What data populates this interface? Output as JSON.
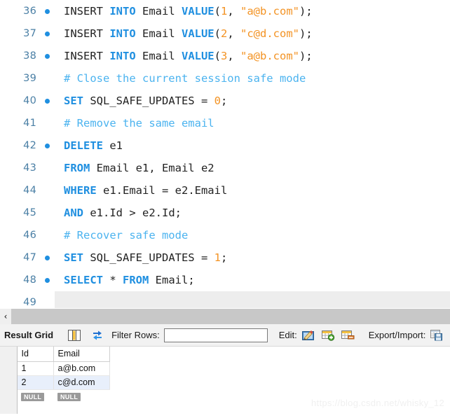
{
  "editor": {
    "lines": [
      {
        "num": "36",
        "bullet": true,
        "current": false,
        "tokens": [
          {
            "t": "INSERT ",
            "c": "plain"
          },
          {
            "t": "INTO",
            "c": "kw"
          },
          {
            "t": " Email ",
            "c": "plain"
          },
          {
            "t": "VALUE",
            "c": "kw"
          },
          {
            "t": "(",
            "c": "plain"
          },
          {
            "t": "1",
            "c": "lit"
          },
          {
            "t": ", ",
            "c": "plain"
          },
          {
            "t": "\"a@b.com\"",
            "c": "lit"
          },
          {
            "t": ");",
            "c": "plain"
          }
        ]
      },
      {
        "num": "37",
        "bullet": true,
        "current": false,
        "tokens": [
          {
            "t": "INSERT ",
            "c": "plain"
          },
          {
            "t": "INTO",
            "c": "kw"
          },
          {
            "t": " Email ",
            "c": "plain"
          },
          {
            "t": "VALUE",
            "c": "kw"
          },
          {
            "t": "(",
            "c": "plain"
          },
          {
            "t": "2",
            "c": "lit"
          },
          {
            "t": ", ",
            "c": "plain"
          },
          {
            "t": "\"c@d.com\"",
            "c": "lit"
          },
          {
            "t": ");",
            "c": "plain"
          }
        ]
      },
      {
        "num": "38",
        "bullet": true,
        "current": false,
        "tokens": [
          {
            "t": "INSERT ",
            "c": "plain"
          },
          {
            "t": "INTO",
            "c": "kw"
          },
          {
            "t": " Email ",
            "c": "plain"
          },
          {
            "t": "VALUE",
            "c": "kw"
          },
          {
            "t": "(",
            "c": "plain"
          },
          {
            "t": "3",
            "c": "lit"
          },
          {
            "t": ", ",
            "c": "plain"
          },
          {
            "t": "\"a@b.com\"",
            "c": "lit"
          },
          {
            "t": ");",
            "c": "plain"
          }
        ]
      },
      {
        "num": "39",
        "bullet": false,
        "current": false,
        "tokens": [
          {
            "t": "# Close the current session safe mode",
            "c": "comment"
          }
        ]
      },
      {
        "num": "40",
        "bullet": true,
        "current": false,
        "tokens": [
          {
            "t": "SET",
            "c": "kw"
          },
          {
            "t": " SQL_SAFE_UPDATES = ",
            "c": "plain"
          },
          {
            "t": "0",
            "c": "lit"
          },
          {
            "t": ";",
            "c": "plain"
          }
        ]
      },
      {
        "num": "41",
        "bullet": false,
        "current": false,
        "tokens": [
          {
            "t": "# Remove the same email",
            "c": "comment"
          }
        ]
      },
      {
        "num": "42",
        "bullet": true,
        "current": false,
        "tokens": [
          {
            "t": "DELETE",
            "c": "kw"
          },
          {
            "t": " e1",
            "c": "plain"
          }
        ]
      },
      {
        "num": "43",
        "bullet": false,
        "current": false,
        "tokens": [
          {
            "t": "FROM",
            "c": "kw"
          },
          {
            "t": " Email e1, Email e2",
            "c": "plain"
          }
        ]
      },
      {
        "num": "44",
        "bullet": false,
        "current": false,
        "tokens": [
          {
            "t": "WHERE",
            "c": "kw"
          },
          {
            "t": " e1.Email = e2.Email",
            "c": "plain"
          }
        ]
      },
      {
        "num": "45",
        "bullet": false,
        "current": false,
        "tokens": [
          {
            "t": "AND",
            "c": "kw"
          },
          {
            "t": " e1.Id > e2.Id;",
            "c": "plain"
          }
        ]
      },
      {
        "num": "46",
        "bullet": false,
        "current": false,
        "tokens": [
          {
            "t": "# Recover safe mode",
            "c": "comment"
          }
        ]
      },
      {
        "num": "47",
        "bullet": true,
        "current": false,
        "tokens": [
          {
            "t": "SET",
            "c": "kw"
          },
          {
            "t": " SQL_SAFE_UPDATES = ",
            "c": "plain"
          },
          {
            "t": "1",
            "c": "lit"
          },
          {
            "t": ";",
            "c": "plain"
          }
        ]
      },
      {
        "num": "48",
        "bullet": true,
        "current": false,
        "tokens": [
          {
            "t": "SELECT",
            "c": "kw"
          },
          {
            "t": " * ",
            "c": "plain"
          },
          {
            "t": "FROM",
            "c": "kw"
          },
          {
            "t": " Email;",
            "c": "plain"
          }
        ]
      },
      {
        "num": "49",
        "bullet": false,
        "current": true,
        "tokens": []
      }
    ]
  },
  "splitter": {
    "collapse_chevron": "‹"
  },
  "result_toolbar": {
    "result_grid_label": "Result Grid",
    "grid_view_icon": "grid-view-icon",
    "refresh_icon": "refresh-icon",
    "filter_rows_label": "Filter Rows:",
    "filter_value": "",
    "filter_placeholder": "",
    "edit_label": "Edit:",
    "edit_icon": "edit-pencil-icon",
    "insert_row_icon": "insert-row-icon",
    "delete_row_icon": "delete-row-icon",
    "export_import_label": "Export/Import:",
    "export_icon": "export-recordset-icon",
    "import_icon": "import-recordset-icon"
  },
  "result_grid": {
    "columns": [
      "Id",
      "Email"
    ],
    "rows": [
      {
        "selector": "▶",
        "Id": "1",
        "Email": "a@b.com",
        "selected": false
      },
      {
        "selector": "",
        "Id": "2",
        "Email": "c@d.com",
        "selected": true
      }
    ],
    "new_row": {
      "selector": "✱",
      "Id": "NULL",
      "Email": "NULL"
    }
  },
  "watermark": {
    "text": "https://blog.csdn.net/whisky_12"
  }
}
